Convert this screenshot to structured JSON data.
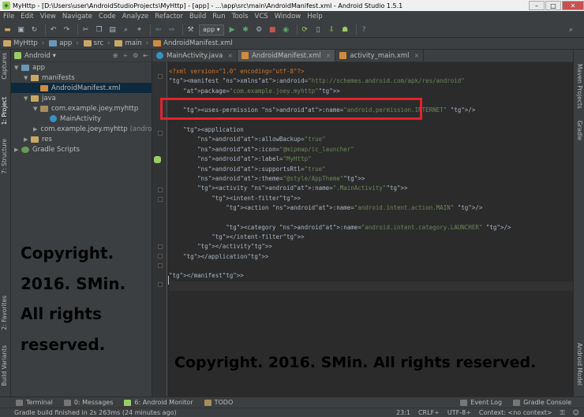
{
  "window": {
    "title": "MyHttp - [D:\\Users\\user\\AndroidStudioProjects\\MyHttp] - [app] - ...\\app\\src\\main\\AndroidManifest.xml - Android Studio 1.5.1",
    "min": "–",
    "max": "□",
    "close": "✕"
  },
  "menu": [
    "File",
    "Edit",
    "View",
    "Navigate",
    "Code",
    "Analyze",
    "Refactor",
    "Build",
    "Run",
    "Tools",
    "VCS",
    "Window",
    "Help"
  ],
  "toolbar": {
    "run_config": "app"
  },
  "breadcrumbs": [
    "MyHttp",
    "app",
    "src",
    "main",
    "AndroidManifest.xml"
  ],
  "left_tabs": [
    "Captures",
    "1: Project",
    "7: Structure",
    "2: Favorites",
    "Build Variants"
  ],
  "right_tabs": [
    "Maven Projects",
    "Gradle",
    "Android Model"
  ],
  "project": {
    "view_selector": "Android",
    "tree": [
      {
        "label": "app",
        "depth": 0,
        "arrow": "▼",
        "icon": "mod"
      },
      {
        "label": "manifests",
        "depth": 1,
        "arrow": "▼",
        "icon": "folder"
      },
      {
        "label": "AndroidManifest.xml",
        "depth": 2,
        "arrow": "",
        "icon": "xml",
        "selected": true
      },
      {
        "label": "java",
        "depth": 1,
        "arrow": "▼",
        "icon": "folder"
      },
      {
        "label": "com.example.joey.myhttp",
        "depth": 2,
        "arrow": "▼",
        "icon": "pkg"
      },
      {
        "label": "MainActivity",
        "depth": 3,
        "arrow": "",
        "icon": "cls"
      },
      {
        "label": "com.example.joey.myhttp",
        "depth": 2,
        "arrow": "▶",
        "icon": "pkg",
        "suffix": "(androidT"
      },
      {
        "label": "res",
        "depth": 1,
        "arrow": "▶",
        "icon": "folder"
      },
      {
        "label": "Gradle Scripts",
        "depth": 0,
        "arrow": "▶",
        "icon": "grd"
      }
    ]
  },
  "editor": {
    "tabs": [
      {
        "label": "MainActivity.java",
        "icon": "java",
        "active": false
      },
      {
        "label": "AndroidManifest.xml",
        "icon": "xml",
        "active": true
      },
      {
        "label": "activity_main.xml",
        "icon": "xml",
        "active": false
      }
    ],
    "lines": [
      "<?xml version=\"1.0\" encoding=\"utf-8\"?>",
      "<manifest xmlns:android=\"http://schemes.android.com/apk/res/android\"",
      "    package=\"com.example.joey.myhttp\">",
      "",
      "    <uses-permission android:name=\"android.permission.INTERNET\" />",
      "",
      "    <application",
      "        android:allowBackup=\"true\"",
      "        android:icon=\"@mipmap/ic_launcher\"",
      "        android:label=\"MyHttp\"",
      "        android:supportsRtl=\"true\"",
      "        android:theme=\"@style/AppTheme\">",
      "        <activity android:name=\".MainActivity\">",
      "            <intent-filter>",
      "                <action android:name=\"android.intent.action.MAIN\" />",
      "",
      "                <category android:name=\"android.intent.category.LAUNCHER\" />",
      "            </intent-filter>",
      "        </activity>",
      "    </application>",
      "",
      "</manifest>",
      ""
    ]
  },
  "watermark_left": [
    "Copyright.",
    "2016. SMin.",
    "All rights",
    "reserved."
  ],
  "watermark_right": "Copyright. 2016. SMin. All rights reserved.",
  "bottom_tabs": [
    "Terminal",
    "0: Messages",
    "6: Android Monitor",
    "TODO"
  ],
  "bottom_right_tabs": [
    "Event Log",
    "Gradle Console"
  ],
  "status": {
    "message": "Gradle build finished in 2s 263ms (24 minutes ago)",
    "position": "23:1",
    "line_sep": "CRLF÷",
    "encoding": "UTF-8÷",
    "context": "Context: <no context>"
  }
}
